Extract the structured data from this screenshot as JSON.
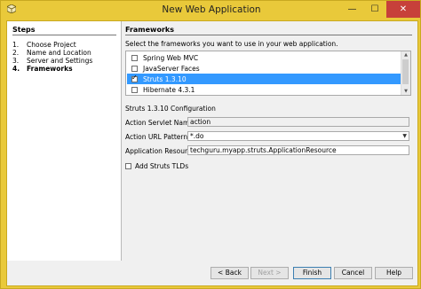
{
  "window": {
    "title": "New Web Application",
    "minimize_glyph": "—",
    "maximize_glyph": "☐",
    "close_glyph": "✕"
  },
  "steps": {
    "title": "Steps",
    "items": [
      {
        "num": "1.",
        "label": "Choose Project"
      },
      {
        "num": "2.",
        "label": "Name and Location"
      },
      {
        "num": "3.",
        "label": "Server and Settings"
      },
      {
        "num": "4.",
        "label": "Frameworks"
      }
    ]
  },
  "frameworks": {
    "title": "Frameworks",
    "instruction": "Select the frameworks you want to use in your web application.",
    "items": [
      {
        "label": "Spring Web MVC",
        "checked": false,
        "selected": false
      },
      {
        "label": "JavaServer Faces",
        "checked": false,
        "selected": false
      },
      {
        "label": "Struts 1.3.10",
        "checked": true,
        "selected": true
      },
      {
        "label": "Hibernate 4.3.1",
        "checked": false,
        "selected": false
      }
    ]
  },
  "config": {
    "title": "Struts 1.3.10 Configuration",
    "servlet_name_label": "Action Servlet Name:",
    "servlet_name_value": "action",
    "url_pattern_label": "Action URL Pattern:",
    "url_pattern_value": "*.do",
    "resource_label": "Application Resource:",
    "resource_value": "techguru.myapp.struts.ApplicationResource",
    "tlds_label": "Add Struts TLDs",
    "tlds_checked": false
  },
  "buttons": {
    "back": "< Back",
    "next": "Next >",
    "finish": "Finish",
    "cancel": "Cancel",
    "help": "Help"
  },
  "colors": {
    "titlebar": "#e9c93a",
    "close": "#c7403a",
    "selection": "#3399ff"
  }
}
